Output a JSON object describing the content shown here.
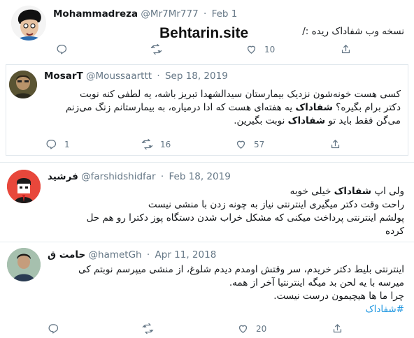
{
  "tweet1": {
    "name": "Mohammadreza",
    "handle": "@Mr7Mr777",
    "date": "Feb 1",
    "text": "نسخه وب شفاداک ریده :/",
    "watermark": "Behtarin.site",
    "reply_count": "",
    "retweet_count": "",
    "like_count": "10"
  },
  "tweet2": {
    "name": "MosarT",
    "handle": "@Moussaarttt",
    "date": "Sep 18, 2019",
    "line1": "کسی هست خونه‌شون نزدیک بیمارستان سیدالشهدا تبریز باشه، یه لطفی کنه نوبت",
    "line2_pre": "دکتر برام بگیره؟ ",
    "line2_bold": "شفاداک",
    "line2_post": " یه هفته‌ای هست که ادا درمیاره، به بیمارستانم زنگ می‌زنم",
    "line3_pre": "می‌گن فقط باید تو ",
    "line3_bold": "شفاداک",
    "line3_post": " نوبت بگیرین.",
    "reply_count": "1",
    "retweet_count": "16",
    "like_count": "57"
  },
  "tweet3": {
    "name": "فرشید",
    "handle": "@farshidshidfar",
    "date": "Feb 18, 2019",
    "line1_pre": "ولی اپ ",
    "line1_bold": "شفاداک",
    "line1_post": " خیلی خوبه",
    "line2": "راحت وقت دکتر میگیری اینترنتی نیاز به چونه زدن با منشی نیست",
    "line3": "پولشم اینترنتی پرداخت میکنی که مشکل خراب شدن دستگاه پوز دکترا رو هم حل",
    "line4": "کرده"
  },
  "tweet4": {
    "name": "حامت ق",
    "handle": "@hametGh",
    "date": "Apr 11, 2018",
    "line1": "اینترنتی بلیط دکتر خریدم، سر وقتش اومدم دیدم شلوغ، از منشی میپرسم نوبتم کی",
    "line2": "میرسه با یه لحن بد میگه اینترنتیا آخر از همه.",
    "line3": "چرا ما ها هیچیمون درست نیست.",
    "hashtag": "#شفاداک",
    "reply_count": "",
    "retweet_count": "",
    "like_count": "20"
  },
  "colors": {
    "text": "#14171a",
    "muted": "#657786",
    "link": "#1b95e0",
    "border": "#e1e8ed"
  },
  "icons": [
    "reply-icon",
    "retweet-icon",
    "like-icon",
    "share-icon"
  ]
}
